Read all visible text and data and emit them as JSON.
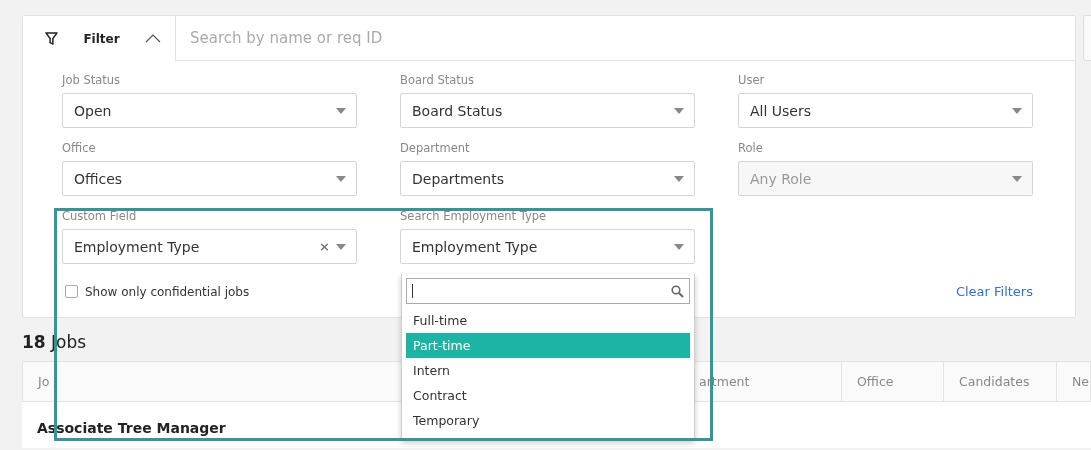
{
  "filter_tab": {
    "label": "Filter",
    "expanded": true
  },
  "search": {
    "placeholder": "Search by name or req ID"
  },
  "filters": [
    {
      "label": "Job Status",
      "value": "Open",
      "disabled": false
    },
    {
      "label": "Board Status",
      "value": "Board Status",
      "disabled": false
    },
    {
      "label": "User",
      "value": "All Users",
      "disabled": false
    },
    {
      "label": "Office",
      "value": "Offices",
      "disabled": false
    },
    {
      "label": "Department",
      "value": "Departments",
      "disabled": false
    },
    {
      "label": "Role",
      "value": "Any Role",
      "disabled": true
    },
    {
      "label": "Custom Field",
      "value": "Employment Type",
      "disabled": false,
      "clear_icon": "×"
    },
    {
      "label": "Search Employment Type",
      "value": "Employment Type",
      "disabled": false,
      "dropdown": {
        "options": [
          {
            "label": "Full-time",
            "selected": false
          },
          {
            "label": "Part-time",
            "selected": true
          },
          {
            "label": "Intern",
            "selected": false
          },
          {
            "label": "Contract",
            "selected": false
          },
          {
            "label": "Temporary",
            "selected": false
          }
        ]
      }
    }
  ],
  "confidential": {
    "label": "Show only confidential jobs",
    "checked": false
  },
  "clear_filters": "Clear Filters",
  "jobs_count": "**18** Jobs",
  "table": {
    "columns": [
      "Jo",
      "artment",
      "Office",
      "Candidates",
      "Ne"
    ],
    "rows": [
      {
        "job": "Associate Tree Manager"
      }
    ]
  }
}
